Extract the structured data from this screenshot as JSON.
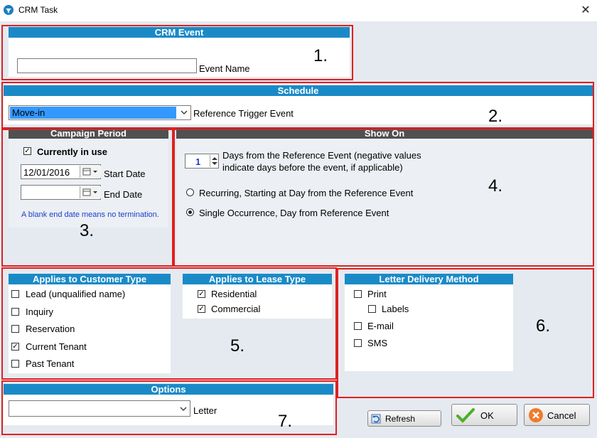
{
  "window": {
    "title": "CRM Task",
    "close": "✕"
  },
  "crm_event": {
    "header": "CRM Event",
    "name_value": "",
    "name_label": "Event Name",
    "marker": "1."
  },
  "schedule": {
    "header": "Schedule",
    "trigger_value": "Move-in",
    "trigger_label": "Reference Trigger Event",
    "marker": "2."
  },
  "campaign": {
    "header": "Campaign Period",
    "currently_in_use_label": "Currently in use",
    "currently_in_use_checked": true,
    "start_date": "12/01/2016",
    "start_label": "Start Date",
    "end_date": "",
    "end_label": "End Date",
    "note": "A blank end date means no termination.",
    "marker": "3."
  },
  "show_on": {
    "header": "Show On",
    "days_value": "1",
    "days_line1": "Days from the Reference Event (negative values",
    "days_line2": "indicate days before the event, if applicable)",
    "recurring_label": "Recurring, Starting at Day from the Reference Event",
    "single_label": "Single Occurrence, Day from Reference Event",
    "selected": "single",
    "marker": "4."
  },
  "customer_type": {
    "header": "Applies to Customer Type",
    "items": [
      {
        "label": "Lead  (unqualified name)",
        "checked": false
      },
      {
        "label": "Inquiry",
        "checked": false
      },
      {
        "label": "Reservation",
        "checked": false
      },
      {
        "label": "Current Tenant",
        "checked": true
      },
      {
        "label": "Past Tenant",
        "checked": false
      }
    ]
  },
  "lease_type": {
    "header": "Applies to Lease Type",
    "items": [
      {
        "label": "Residential",
        "checked": true
      },
      {
        "label": "Commercial",
        "checked": true
      }
    ],
    "marker": "5."
  },
  "letter_delivery": {
    "header": "Letter Delivery Method",
    "items": [
      {
        "label": "Print",
        "checked": false
      },
      {
        "label": "Labels",
        "checked": false
      },
      {
        "label": "E-mail",
        "checked": false
      },
      {
        "label": "SMS",
        "checked": false
      }
    ],
    "marker": "6."
  },
  "options": {
    "header": "Options",
    "letter_value": "",
    "letter_label": "Letter",
    "marker": "7."
  },
  "buttons": {
    "refresh": "Refresh",
    "ok": "OK",
    "cancel": "Cancel"
  },
  "colors": {
    "header_blue": "#1a8ac7",
    "header_dark": "#505050",
    "annotation_red": "#e02020",
    "selection_blue": "#3399ff"
  }
}
